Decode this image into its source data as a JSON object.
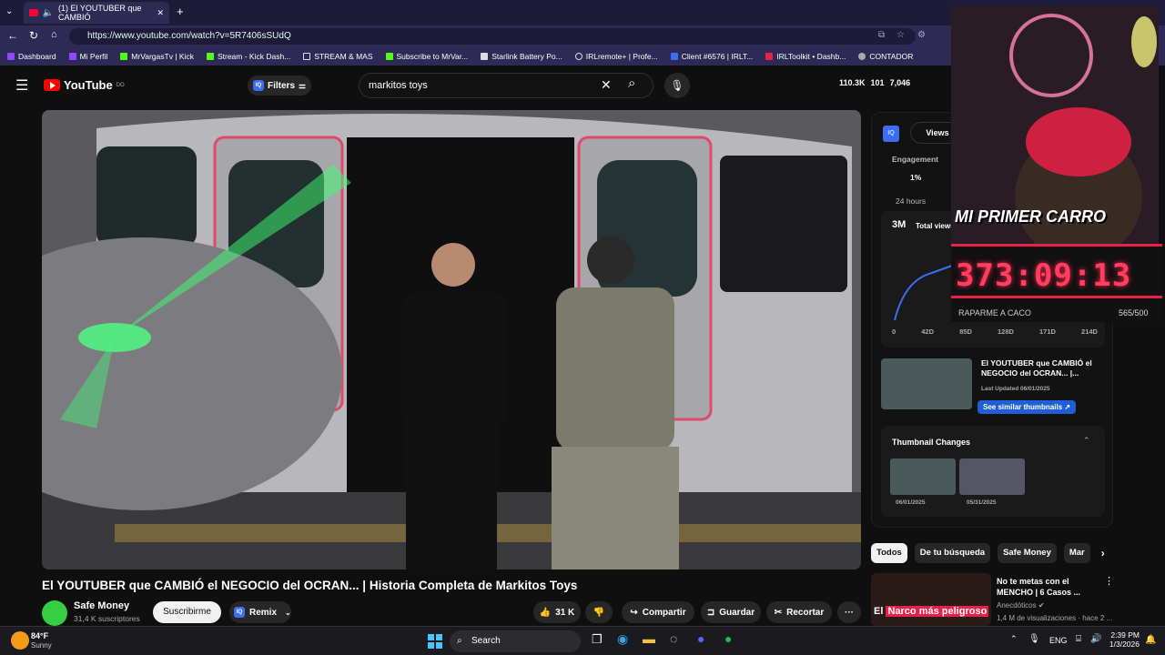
{
  "browser": {
    "tab_title": "(1) El YOUTUBER que CAMBIÓ",
    "url": "https://www.youtube.com/watch?v=5R7406sSUdQ",
    "bookmarks": [
      "Dashboard",
      "Mi Perfil",
      "MrVargasTv | Kick",
      "Stream - Kick Dash...",
      "STREAM & MAS",
      "Subscribe to MrVar...",
      "Starlink Battery Po...",
      "IRLremote+ | Profe...",
      "Client #6576 | IRLT...",
      "IRLToolkit • Dashb...",
      "CONTADOR"
    ]
  },
  "youtube": {
    "logo": "YouTube",
    "logo_region": "DO",
    "filters_label": "Filters",
    "search_value": "markitos toys",
    "stats": [
      "110.3K",
      "101",
      "7,046"
    ]
  },
  "video": {
    "title": "El YOUTUBER que CAMBIÓ el NEGOCIO del OCRAN... | Historia Completa de Markitos Toys",
    "channel_name": "Safe Money",
    "channel_subs": "31,4 K suscriptores",
    "subscribe_label": "Suscribirme",
    "remix_label": "Remix",
    "likes": "31 K",
    "share_label": "Compartir",
    "save_label": "Guardar",
    "clip_label": "Recortar"
  },
  "iq_panel": {
    "views_tab": "Views",
    "engagement_label": "Engagement",
    "engagement_value": "1%",
    "period": "24 hours",
    "total_views_value": "3M",
    "total_views_label": "Total views",
    "x_ticks": [
      "0",
      "42D",
      "85D",
      "128D",
      "171D",
      "214D"
    ],
    "thumb_title": "El YOUTUBER que CAMBIÓ el NEGOCIO del OCRAN... |...",
    "thumb_updated": "Last Updated 06/01/2025",
    "similar_label": "See similar thumbnails",
    "thumb_changes_title": "Thumbnail Changes",
    "thumb_dates": [
      "06/01/2025",
      "05/31/2025"
    ]
  },
  "chips": [
    "Todos",
    "De tu búsqueda",
    "Safe Money",
    "Mar"
  ],
  "recommended": {
    "title": "No te metas con el MENCHO | 6 Casos ...",
    "channel": "Anecdóticos",
    "meta": "1,4 M de visualizaciones · hace 2 ...",
    "thumb_text_white": "El",
    "thumb_text_red": "Narco más peligroso"
  },
  "overlay": {
    "banner": "MI PRIMER CARRO",
    "timer": "373:09:13",
    "footer_left": "RAPARME A CACO",
    "footer_right": "565/500"
  },
  "taskbar": {
    "weather_temp": "84°F",
    "weather_desc": "Sunny",
    "search_label": "Search",
    "lang": "ENG",
    "time": "2:39 PM",
    "date": "1/3/2026"
  }
}
